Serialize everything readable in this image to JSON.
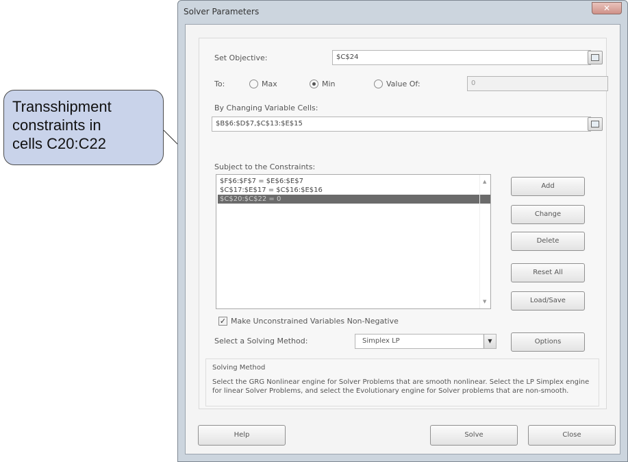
{
  "callout": {
    "lines": [
      "Transshipment",
      "constraints in",
      "cells C20:C22"
    ]
  },
  "window": {
    "title": "Solver Parameters",
    "close_icon": "close-icon"
  },
  "objective": {
    "label": "Set Objective:",
    "value": "$C$24"
  },
  "to": {
    "label": "To:",
    "options": [
      {
        "label": "Max",
        "selected": false
      },
      {
        "label": "Min",
        "selected": true
      },
      {
        "label": "Value Of:",
        "selected": false
      }
    ],
    "value_of": "0"
  },
  "changing": {
    "label": "By Changing Variable Cells:",
    "value": "$B$6:$D$7,$C$13:$E$15"
  },
  "constraints": {
    "label": "Subject to the Constraints:",
    "items": [
      {
        "text": "$F$6:$F$7 = $E$6:$E$7",
        "selected": false
      },
      {
        "text": "$C$17:$E$17 = $C$16:$E$16",
        "selected": false
      },
      {
        "text": "$C$20:$C$22 = 0",
        "selected": true
      }
    ]
  },
  "side_buttons": {
    "add": "Add",
    "change": "Change",
    "delete": "Delete",
    "reset_all": "Reset All",
    "load_save": "Load/Save"
  },
  "nonneg": {
    "label": "Make Unconstrained Variables Non-Negative",
    "checked": true
  },
  "method": {
    "label": "Select a Solving Method:",
    "value": "Simplex LP",
    "options_button": "Options",
    "box_title": "Solving Method",
    "description": "Select the GRG Nonlinear engine for Solver Problems that are smooth nonlinear. Select the LP Simplex engine for linear Solver Problems, and select the Evolutionary engine for Solver problems that are non-smooth."
  },
  "footer": {
    "help": "Help",
    "solve": "Solve",
    "close": "Close"
  },
  "colors": {
    "callout_fill": "#c9d3ea",
    "selection": "#6b6b6b",
    "window_frame": "#ccd5de"
  }
}
